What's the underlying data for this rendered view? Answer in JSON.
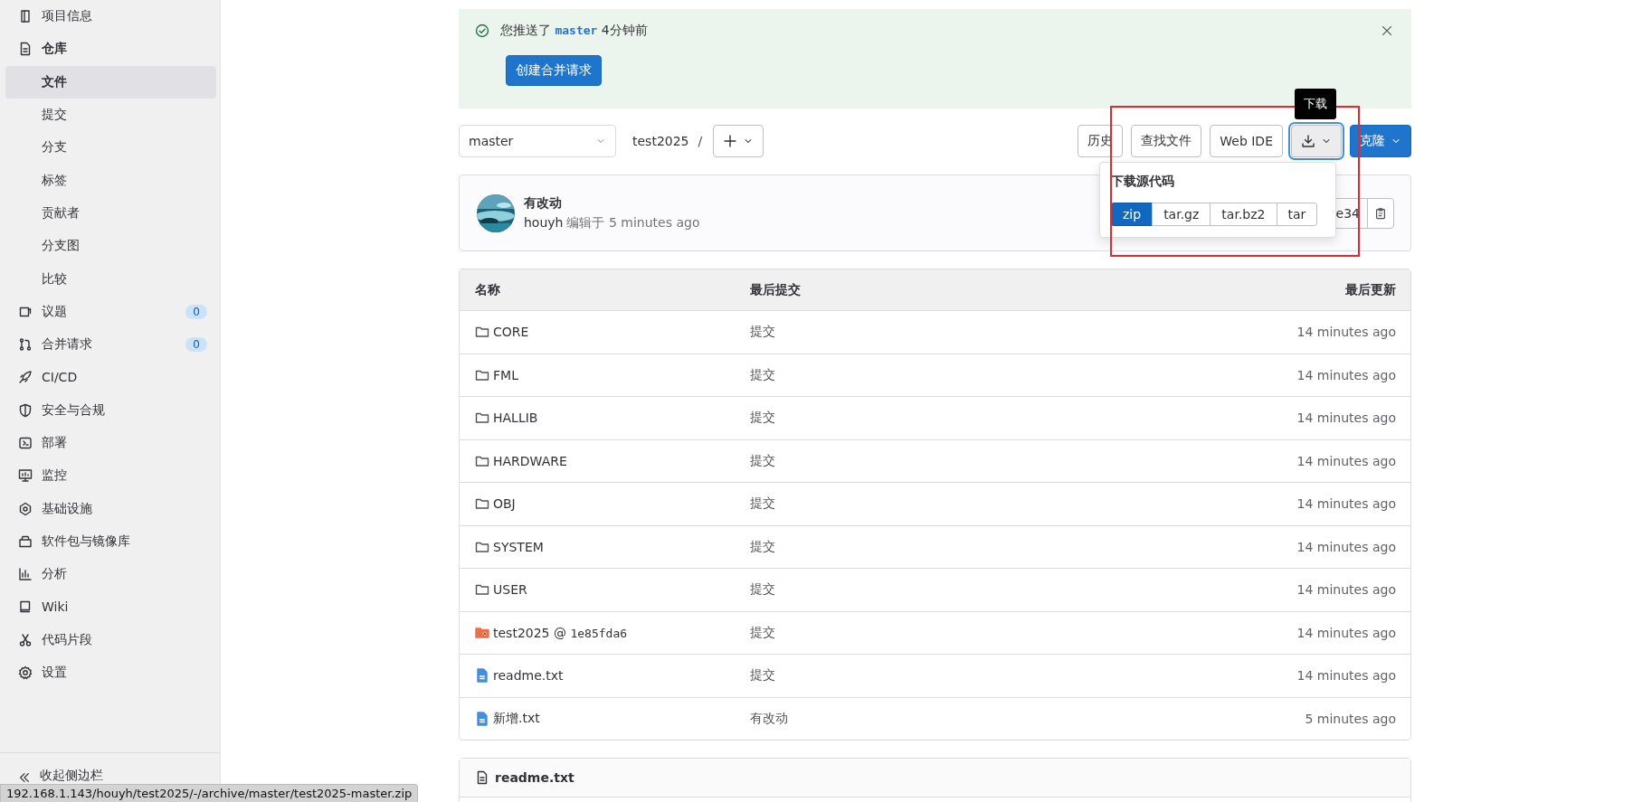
{
  "sidebar": {
    "items": [
      {
        "label": "项目信息",
        "selected": false
      },
      {
        "label": "仓库",
        "selected": false,
        "expanded": true,
        "children": [
          {
            "label": "文件",
            "selected": true
          },
          {
            "label": "提交",
            "selected": false
          },
          {
            "label": "分支",
            "selected": false
          },
          {
            "label": "标签",
            "selected": false
          },
          {
            "label": "贡献者",
            "selected": false
          },
          {
            "label": "分支图",
            "selected": false
          },
          {
            "label": "比较",
            "selected": false
          }
        ]
      },
      {
        "label": "议题",
        "selected": false,
        "count": "0"
      },
      {
        "label": "合并请求",
        "selected": false,
        "count": "0"
      },
      {
        "label": "CI/CD",
        "selected": false
      },
      {
        "label": "安全与合规",
        "selected": false
      },
      {
        "label": "部署",
        "selected": false
      },
      {
        "label": "监控",
        "selected": false
      },
      {
        "label": "基础设施",
        "selected": false
      },
      {
        "label": "软件包与镜像库",
        "selected": false
      },
      {
        "label": "分析",
        "selected": false
      },
      {
        "label": "Wiki",
        "selected": false
      },
      {
        "label": "代码片段",
        "selected": false
      },
      {
        "label": "设置",
        "selected": false
      }
    ],
    "collapse": "收起侧边栏"
  },
  "alert": {
    "prefix": "您推送了",
    "branch": "master",
    "suffix": "4分钟前",
    "button": "创建合并请求"
  },
  "toolbar": {
    "branch": "master",
    "path": "test2025",
    "separator": "/",
    "buttons": [
      "历史",
      "查找文件",
      "Web IDE"
    ],
    "download": {
      "expanded": true,
      "tooltip": "下载",
      "menu_title": "下载源代码",
      "formats": [
        {
          "label": "zip",
          "selected": true
        },
        {
          "label": "tar.gz",
          "selected": false
        },
        {
          "label": "tar.bz2",
          "selected": false
        },
        {
          "label": "tar",
          "selected": false
        }
      ]
    },
    "clone": "克隆"
  },
  "commit": {
    "title": "有改动",
    "author": "houyh",
    "meta": "编辑于 5 minutes ago",
    "sha": "e34"
  },
  "table": {
    "columns": [
      "名称",
      "最后提交",
      "最后更新"
    ],
    "rows": [
      {
        "kind": "folder",
        "name": "CORE",
        "commit": "提交",
        "updated": "14 minutes ago"
      },
      {
        "kind": "folder",
        "name": "FML",
        "commit": "提交",
        "updated": "14 minutes ago"
      },
      {
        "kind": "folder",
        "name": "HALLIB",
        "commit": "提交",
        "updated": "14 minutes ago"
      },
      {
        "kind": "folder",
        "name": "HARDWARE",
        "commit": "提交",
        "updated": "14 minutes ago"
      },
      {
        "kind": "folder",
        "name": "OBJ",
        "commit": "提交",
        "updated": "14 minutes ago"
      },
      {
        "kind": "folder",
        "name": "SYSTEM",
        "commit": "提交",
        "updated": "14 minutes ago"
      },
      {
        "kind": "folder",
        "name": "USER",
        "commit": "提交",
        "updated": "14 minutes ago"
      },
      {
        "kind": "submodule",
        "name": "test2025",
        "at": "@",
        "sha": "1e85fda6",
        "commit": "提交",
        "updated": "14 minutes ago"
      },
      {
        "kind": "file",
        "name": "readme.txt",
        "commit": "提交",
        "updated": "14 minutes ago"
      },
      {
        "kind": "file",
        "name": "新增.txt",
        "commit": "有改动",
        "updated": "5 minutes ago"
      }
    ]
  },
  "readme": {
    "title": "readme.txt"
  },
  "status_bar": {
    "url": "192.168.1.143/houyh/test2025/-/archive/master/test2025-master.zip"
  }
}
